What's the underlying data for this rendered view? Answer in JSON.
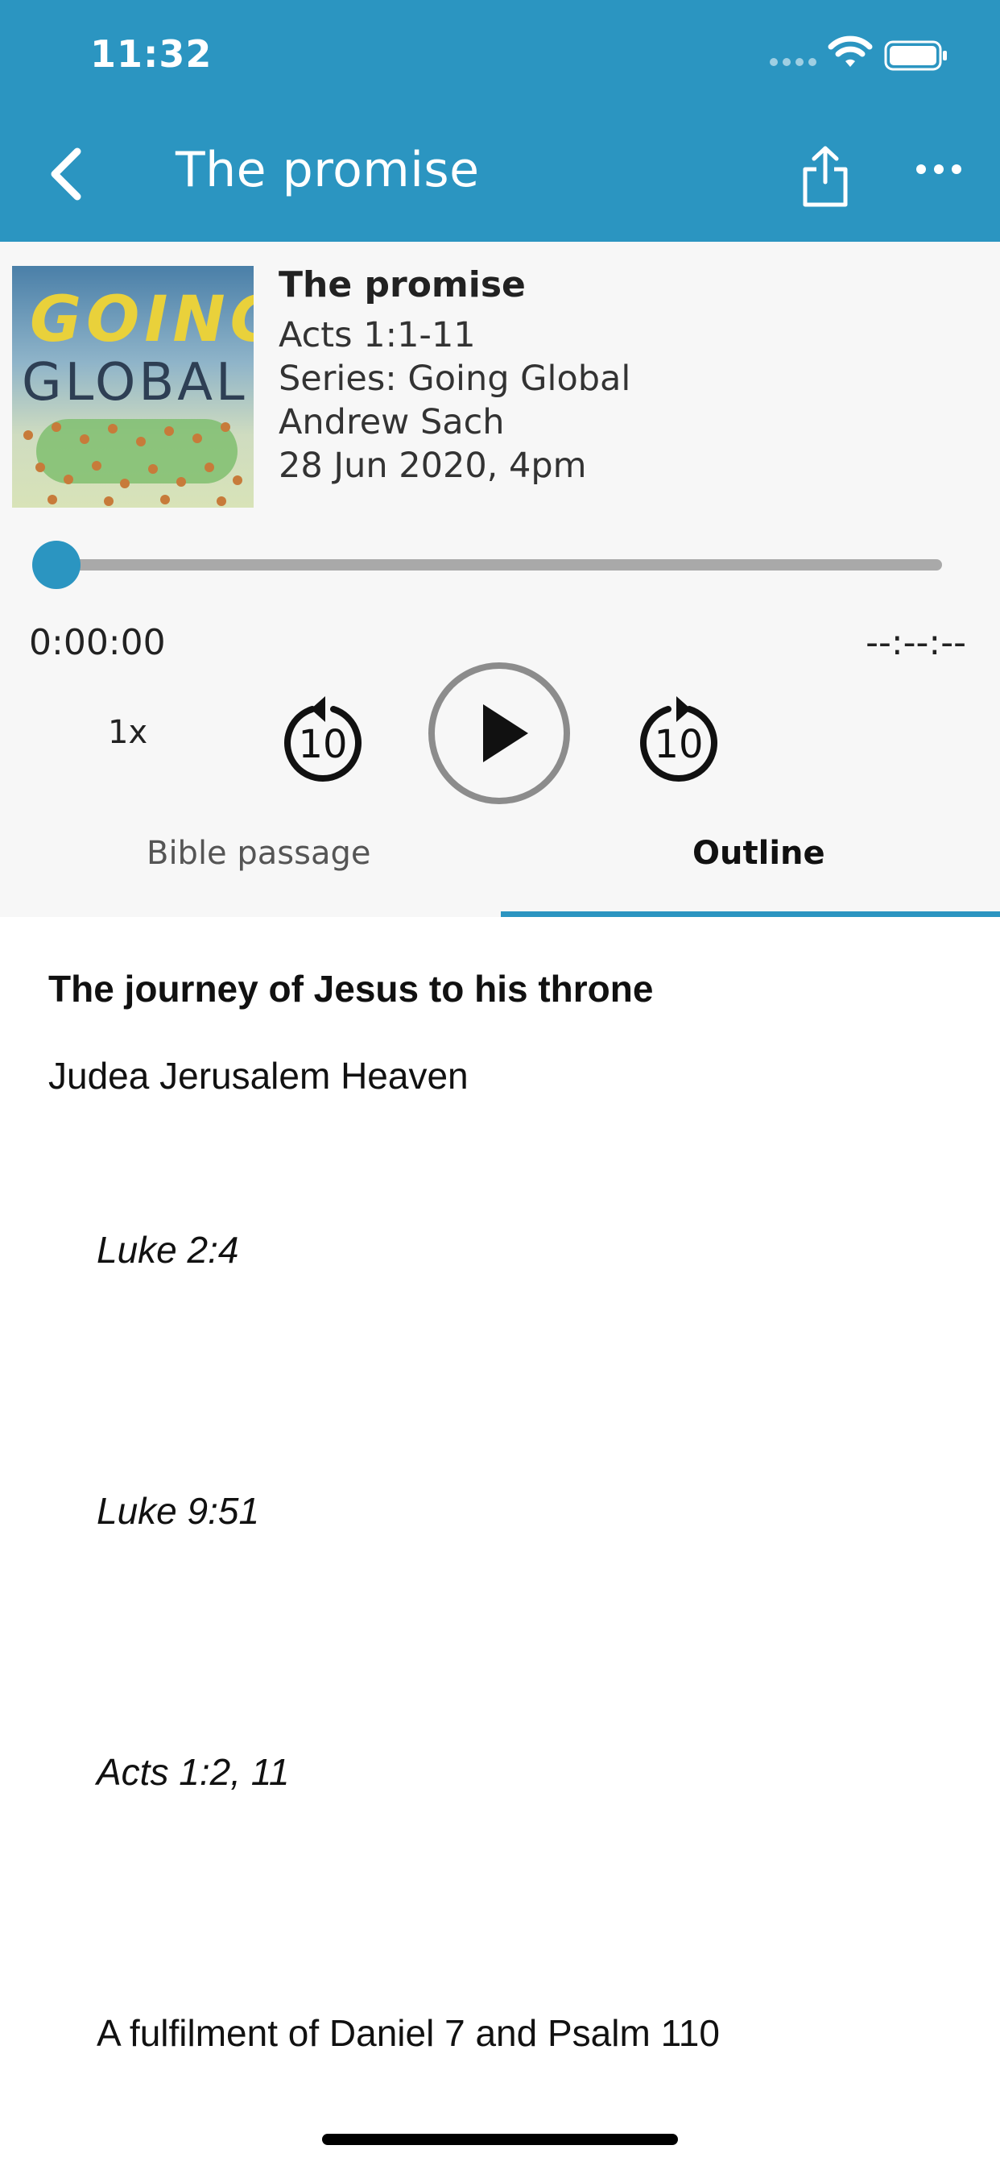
{
  "status_bar": {
    "time": "11:32"
  },
  "header": {
    "title": "The promise"
  },
  "colors": {
    "accent": "#2b95c1",
    "panel": "#f7f7f7"
  },
  "artwork": {
    "line1": "GOING",
    "line2": "GLOBAL"
  },
  "sermon": {
    "title": "The promise",
    "passage": "Acts 1:1-11",
    "series": "Series: Going Global",
    "speaker": "Andrew Sach",
    "date": "28 Jun 2020, 4pm"
  },
  "player": {
    "progress": 0,
    "elapsed": "0:00:00",
    "total": "--:--:--",
    "speed": "1x",
    "skip_back_seconds": "10",
    "skip_forward_seconds": "10"
  },
  "tabs": [
    {
      "label": "Bible passage",
      "selected": false
    },
    {
      "label": "Outline",
      "selected": true
    }
  ],
  "outline": {
    "heading": "The journey of Jesus to his throne",
    "subheading": "Judea Jerusalem Heaven",
    "references": [
      "Luke 2:4",
      "Luke 9:51",
      "Acts 1:2, 11"
    ],
    "fulfilment": "A fulfilment of Daniel 7 and Psalm 110"
  }
}
